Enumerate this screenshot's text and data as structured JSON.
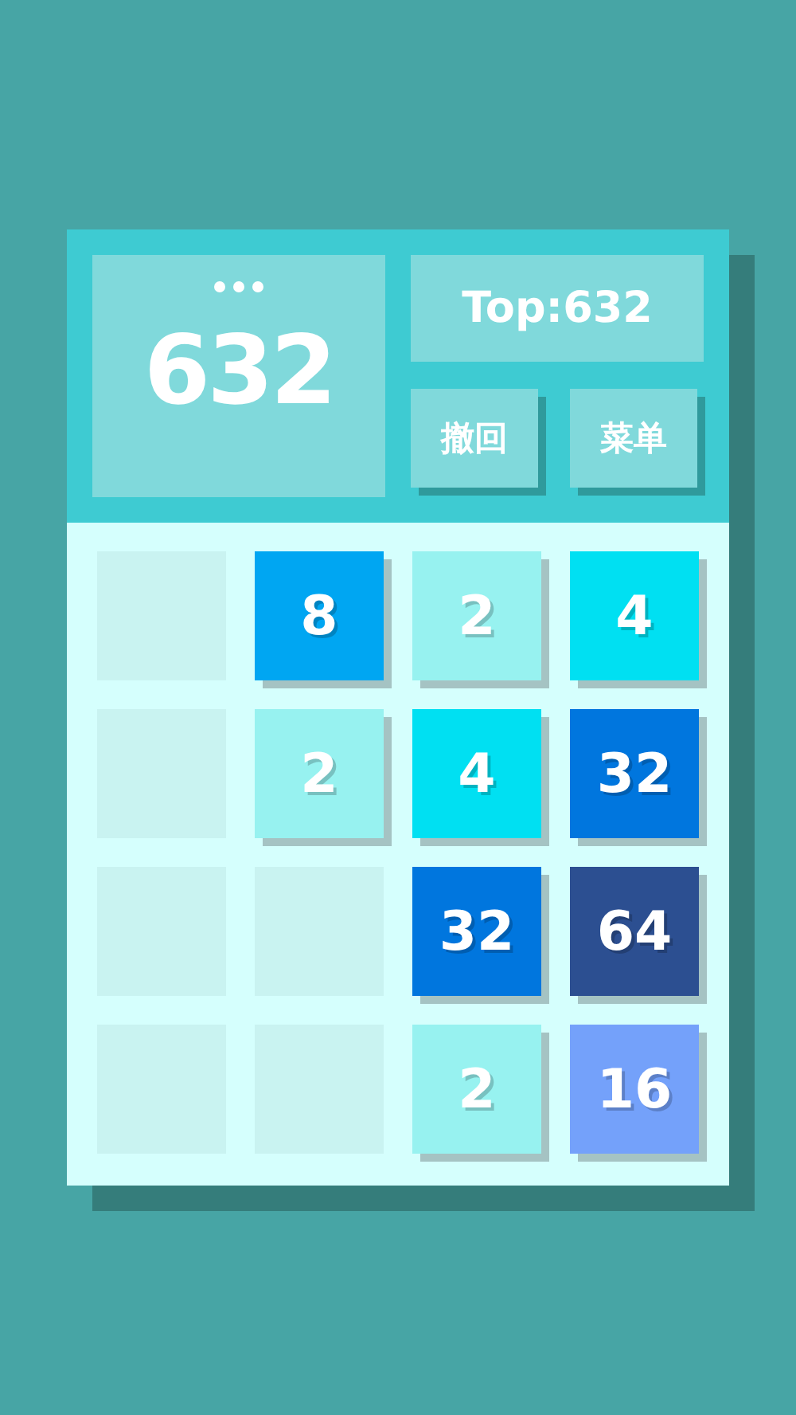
{
  "score": "632",
  "top": "Top:632",
  "buttons": [
    "撤回",
    "菜单"
  ],
  "board": [
    [
      {
        "kind": "empty"
      },
      {
        "kind": "tile",
        "value": "8",
        "color": "#00a6f2"
      },
      {
        "kind": "tile",
        "value": "2",
        "color": "#97f2f0"
      },
      {
        "kind": "tile",
        "value": "4",
        "color": "#00e0f2"
      }
    ],
    [
      {
        "kind": "empty"
      },
      {
        "kind": "tile",
        "value": "2",
        "color": "#97f2f0"
      },
      {
        "kind": "tile",
        "value": "4",
        "color": "#00e0f2"
      },
      {
        "kind": "tile",
        "value": "32",
        "color": "#0076de"
      }
    ],
    [
      {
        "kind": "empty"
      },
      {
        "kind": "empty"
      },
      {
        "kind": "tile",
        "value": "32",
        "color": "#0076de"
      },
      {
        "kind": "tile",
        "value": "64",
        "color": "#2c4f91"
      }
    ],
    [
      {
        "kind": "empty"
      },
      {
        "kind": "empty"
      },
      {
        "kind": "tile",
        "value": "2",
        "color": "#97f2f0"
      },
      {
        "kind": "tile",
        "value": "16",
        "color": "#74a1fa"
      }
    ]
  ]
}
